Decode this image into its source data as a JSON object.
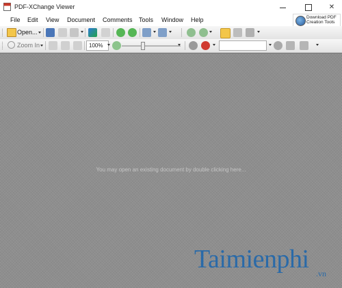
{
  "window": {
    "title": "PDF-XChange Viewer",
    "controls": {
      "minimize": "—",
      "maximize": "☐",
      "close": "✕"
    }
  },
  "menu": [
    "File",
    "Edit",
    "View",
    "Document",
    "Comments",
    "Tools",
    "Window",
    "Help"
  ],
  "download_promo": {
    "label": "Download PDF\nCreation Tools",
    "icon": "download-tools-icon"
  },
  "toolbar1": {
    "open_label": "Open...",
    "icons": [
      "save-icon",
      "print-icon",
      "scan-icon",
      "email-icon",
      "pdf-icon",
      "back-icon",
      "forward-icon",
      "undo-icon",
      "redo-icon",
      "rotate-left-icon",
      "rotate-right-icon",
      "hand-tool-icon",
      "select-icon",
      "snapshot-icon"
    ]
  },
  "toolbar2": {
    "zoom_label": "Zoom In",
    "zoom_value": "100%",
    "icons": [
      "zoom-in-icon",
      "actual-size-icon",
      "fit-page-icon",
      "fit-width-icon",
      "zoom-out-icon",
      "find-icon",
      "search-icon",
      "highlight-icon",
      "settings-icon"
    ]
  },
  "workspace": {
    "hint": "You may open an existing document by double clicking here..."
  },
  "watermark": {
    "text": "Taimienphi",
    "suffix": ".vn"
  },
  "colors": {
    "workspace": "#8e8e8e",
    "accent": "#2a6aa8",
    "highlight": "#f3c64a"
  }
}
